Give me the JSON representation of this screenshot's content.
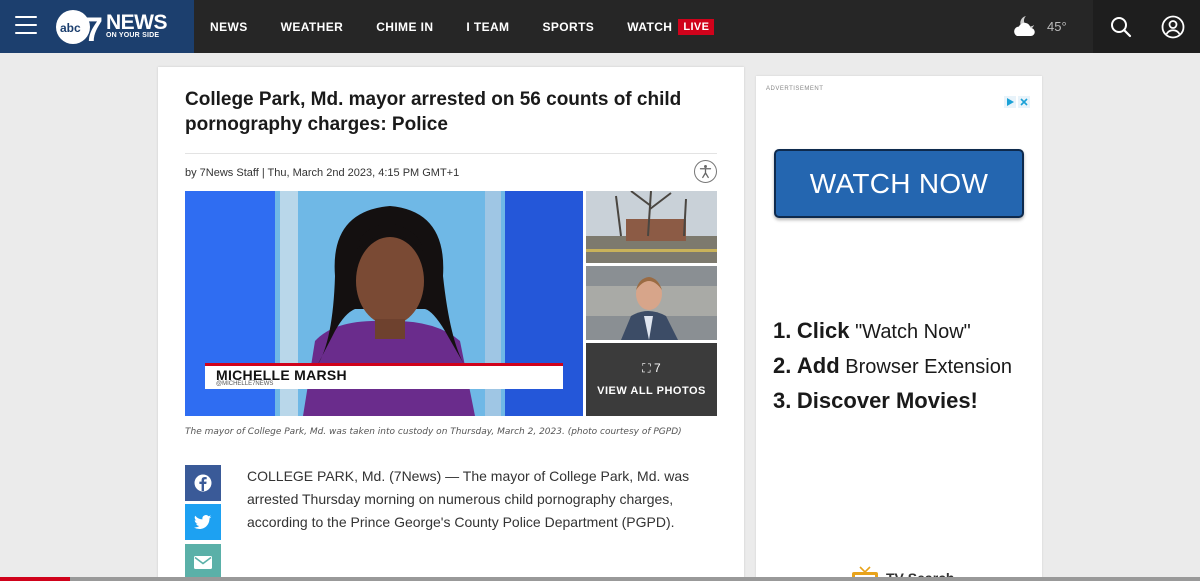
{
  "header": {
    "logo_news": "NEWS",
    "logo_tagline": "ON YOUR SIDE",
    "nav": [
      "NEWS",
      "WEATHER",
      "CHIME IN",
      "I TEAM",
      "SPORTS"
    ],
    "watch_label": "WATCH",
    "live_label": "LIVE",
    "temperature": "45°",
    "colors": {
      "brand": "#1c3f6e",
      "live": "#d0021b",
      "bar": "#262626"
    }
  },
  "article": {
    "headline": "College Park, Md. mayor arrested on 56 counts of child pornography charges: Police",
    "byline": "by 7News Staff | Thu, March 2nd 2023, 4:15 PM GMT+1",
    "hero": {
      "lower_third_name": "MICHELLE MARSH",
      "lower_third_handle": "@MICHELLE7NEWS"
    },
    "gallery": {
      "count": "7",
      "label": "VIEW ALL PHOTOS"
    },
    "caption": "The mayor of College Park, Md. was taken into custody on Thursday, March 2, 2023. (photo courtesy of PGPD)",
    "body": "COLLEGE PARK, Md. (7News) — The mayor of College Park, Md. was arrested Thursday morning on numerous child pornography charges, according to the Prince George's County Police Department (PGPD).",
    "share_icons": [
      "facebook-icon",
      "twitter-icon",
      "email-icon"
    ]
  },
  "ad": {
    "label": "ADVERTISEMENT",
    "button": "WATCH NOW",
    "steps": [
      {
        "num": "1.",
        "verb": "Click",
        "object": "\"Watch Now\""
      },
      {
        "num": "2.",
        "verb": "Add",
        "object": "Browser Extension"
      },
      {
        "num": "3.",
        "verb": "Discover Movies!",
        "object": ""
      }
    ],
    "footer": "TV Search"
  },
  "reading_progress": 0.058
}
